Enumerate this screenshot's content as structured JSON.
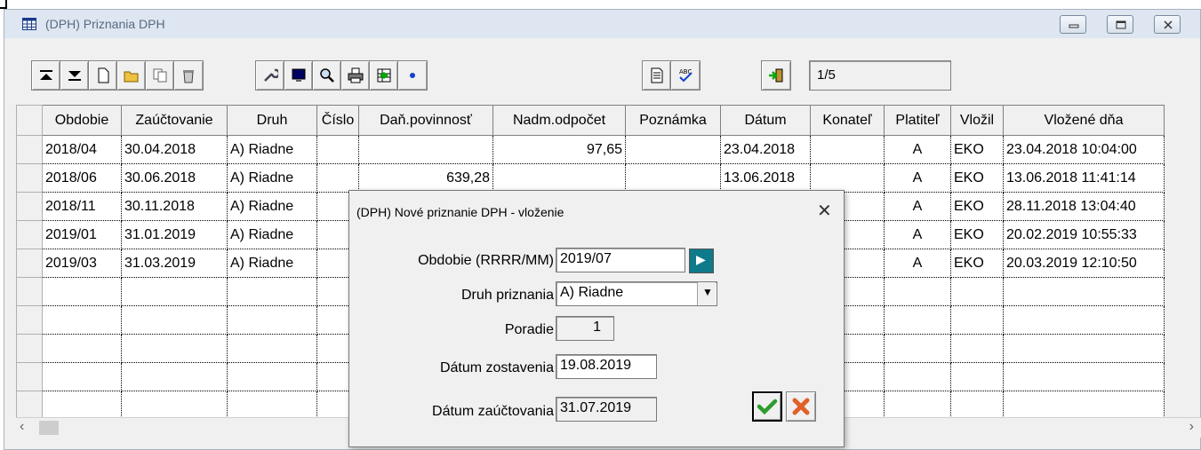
{
  "window": {
    "title": "(DPH) Priznania DPH"
  },
  "toolbar": {
    "record_counter": "1/5"
  },
  "grid": {
    "columns": [
      "Obdobie",
      "Zaúčtovanie",
      "Druh",
      "Číslo",
      "Daň.povinnosť",
      "Nadm.odpočet",
      "Poznámka",
      "Dátum",
      "Konateľ",
      "Platiteľ",
      "Vložil",
      "Vložené dňa"
    ],
    "rows": [
      [
        "2018/04",
        "30.04.2018",
        "A) Riadne",
        "",
        "",
        "97,65",
        "",
        "23.04.2018",
        "",
        "A",
        "EKO",
        "23.04.2018 10:04:00"
      ],
      [
        "2018/06",
        "30.06.2018",
        "A) Riadne",
        "",
        "639,28",
        "",
        "",
        "13.06.2018",
        "",
        "A",
        "EKO",
        "13.06.2018 11:41:14"
      ],
      [
        "2018/11",
        "30.11.2018",
        "A) Riadne",
        "",
        "",
        "",
        "",
        "",
        "",
        "A",
        "EKO",
        "28.11.2018 13:04:40"
      ],
      [
        "2019/01",
        "31.01.2019",
        "A) Riadne",
        "",
        "",
        "",
        "",
        "",
        "",
        "A",
        "EKO",
        "20.02.2019 10:55:33"
      ],
      [
        "2019/03",
        "31.03.2019",
        "A) Riadne",
        "",
        "",
        "",
        "",
        "",
        "",
        "A",
        "EKO",
        "20.03.2019 12:10:50"
      ]
    ],
    "empty_rows": 5
  },
  "dialog": {
    "title": "(DPH) Nové priznanie DPH - vloženie",
    "close": "✕",
    "period_label": "Obdobie (RRRR/MM)",
    "period_value": "2019/07",
    "type_label": "Druh priznania",
    "type_value": "A) Riadne",
    "order_label": "Poradie",
    "order_value": "1",
    "created_label": "Dátum zostavenia",
    "created_value": "19.08.2019",
    "posting_label": "Dátum zaúčtovania",
    "posting_value": "31.07.2019"
  },
  "colors": {
    "titlebar": "#dde6f1",
    "ok_green": "#2e9c2e",
    "cancel_orange": "#e0602a"
  }
}
